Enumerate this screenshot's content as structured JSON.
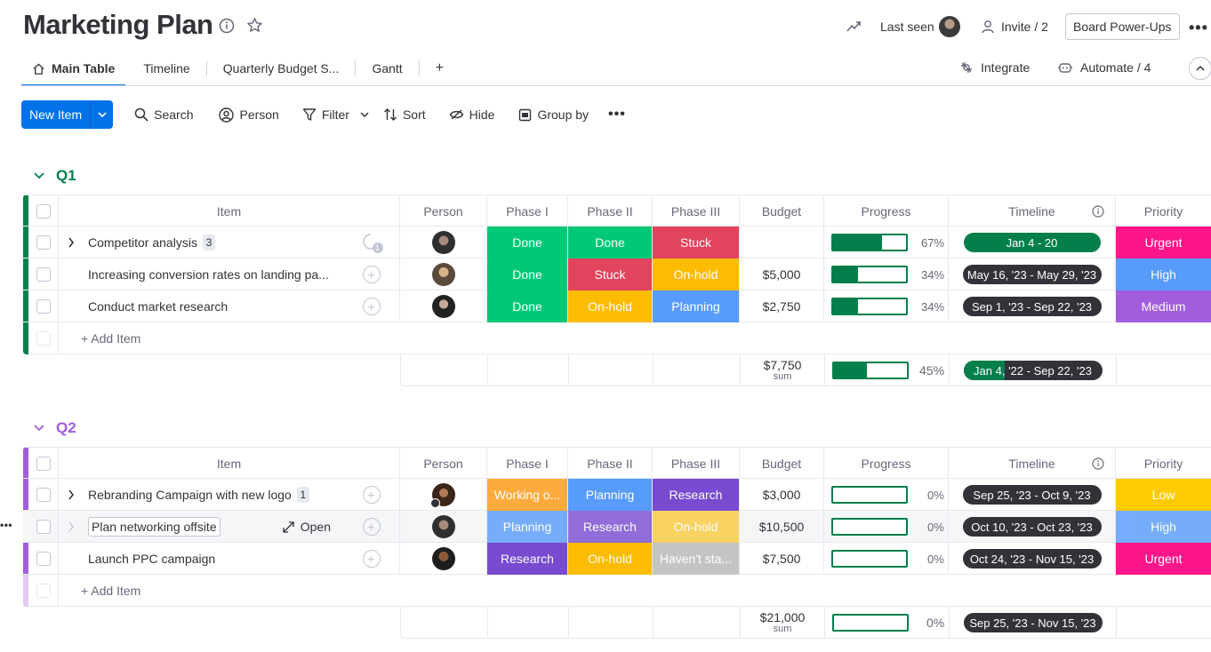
{
  "header": {
    "title": "Marketing Plan",
    "last_seen": "Last seen",
    "invite": "Invite / 2",
    "power_ups": "Board Power-Ups",
    "integrate": "Integrate",
    "automate": "Automate / 4"
  },
  "tabs": [
    "Main Table",
    "Timeline",
    "Quarterly Budget S...",
    "Gantt",
    "+"
  ],
  "toolbar": {
    "new_item": "New Item",
    "search": "Search",
    "person": "Person",
    "filter": "Filter",
    "sort": "Sort",
    "hide": "Hide",
    "group_by": "Group by"
  },
  "columns": {
    "item": "Item",
    "person": "Person",
    "phase1": "Phase I",
    "phase2": "Phase II",
    "phase3": "Phase III",
    "budget": "Budget",
    "progress": "Progress",
    "timeline": "Timeline",
    "priority": "Priority"
  },
  "colors": {
    "done": "#00c875",
    "stuck": "#e2445c",
    "onhold": "#fdbc00",
    "planning": "#579bfc",
    "working": "#fdab3d",
    "research": "#784bd1",
    "havent": "#c4c4c4",
    "urgent": "#ff158a",
    "high": "#579bfc",
    "medium": "#a25ddc",
    "low": "#ffcb00",
    "q1": "#037f4c",
    "q2": "#a25ddc"
  },
  "add_item": "+ Add Item",
  "open_label": "Open",
  "sum_label": "sum",
  "groups": [
    {
      "name": "Q1",
      "rows": [
        {
          "name": "Competitor analysis",
          "subitems": "3",
          "phase1": "Done",
          "phase2": "Done",
          "phase3": "Stuck",
          "budget": "",
          "progress": "67%",
          "timeline": "Jan 4 - 20",
          "priority": "Urgent"
        },
        {
          "name": "Increasing conversion rates on landing pa...",
          "subitems": "",
          "phase1": "Done",
          "phase2": "Stuck",
          "phase3": "On-hold",
          "budget": "$5,000",
          "progress": "34%",
          "timeline": "May 16, '23 - May 29, '23",
          "priority": "High"
        },
        {
          "name": "Conduct market research",
          "subitems": "",
          "phase1": "Done",
          "phase2": "On-hold",
          "phase3": "Planning",
          "budget": "$2,750",
          "progress": "34%",
          "timeline": "Sep 1, '23 - Sep 22, '23",
          "priority": "Medium"
        }
      ],
      "summary": {
        "budget": "$7,750",
        "progress": "45%",
        "timeline": "Jan 4, '22 - Sep 22, '23"
      }
    },
    {
      "name": "Q2",
      "rows": [
        {
          "name": "Rebranding Campaign with new logo",
          "subitems": "1",
          "phase1": "Working o...",
          "phase2": "Planning",
          "phase3": "Research",
          "budget": "$3,000",
          "progress": "0%",
          "timeline": "Sep 25, '23 - Oct 9, '23",
          "priority": "Low"
        },
        {
          "name": "Plan networking offsite",
          "subitems": "",
          "phase1": "Planning",
          "phase2": "Research",
          "phase3": "On-hold",
          "budget": "$10,500",
          "progress": "0%",
          "timeline": "Oct 10, '23 - Oct 23, '23",
          "priority": "High"
        },
        {
          "name": "Launch PPC campaign",
          "subitems": "",
          "phase1": "Research",
          "phase2": "On-hold",
          "phase3": "Haven't sta...",
          "budget": "$7,500",
          "progress": "0%",
          "timeline": "Oct 24, '23 - Nov 15, '23",
          "priority": "Urgent"
        }
      ],
      "summary": {
        "budget": "$21,000",
        "progress": "0%",
        "timeline": "Sep 25, '23 - Nov 15, '23"
      }
    }
  ]
}
